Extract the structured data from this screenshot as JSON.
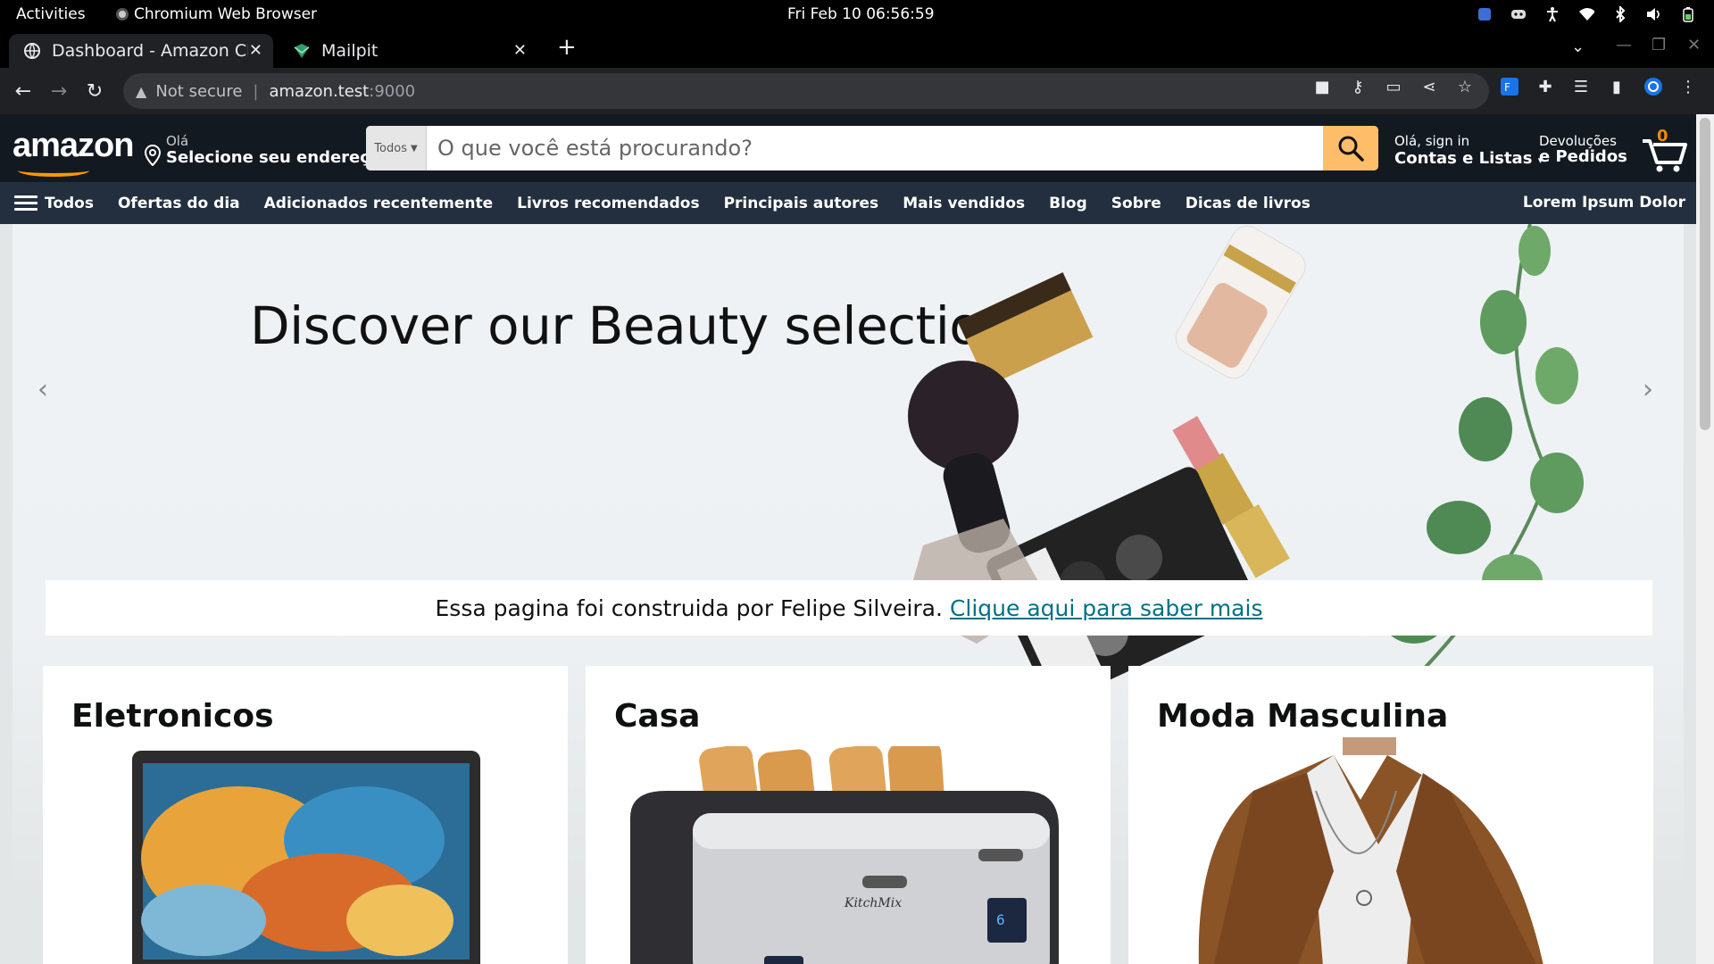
{
  "system_bar": {
    "activities": "Activities",
    "app_name": "Chromium Web Browser",
    "clock": "Fri Feb 10  06:56:59"
  },
  "browser": {
    "tabs": [
      {
        "label": "Dashboard - Amazon Clo",
        "active": true
      },
      {
        "label": "Mailpit",
        "active": false
      }
    ],
    "omnibox": {
      "security": "Not secure",
      "host": "amazon.test",
      "port": ":9000"
    }
  },
  "header": {
    "logo": "amazon",
    "address_line1": "Olá",
    "address_line2": "Selecione seu endereço",
    "search_category": "Todos",
    "search_placeholder": "O que você está procurando?",
    "account_line1": "Olá, sign in",
    "account_line2": "Contas e Listas",
    "orders_line1": "Devoluções",
    "orders_line2": "e Pedidos",
    "cart_count": "0"
  },
  "nav": {
    "all_label": "Todos",
    "items": [
      "Ofertas do dia",
      "Adicionados recentemente",
      "Livros recomendados",
      "Principais autores",
      "Mais vendidos",
      "Blog",
      "Sobre",
      "Dicas de livros"
    ],
    "right_label": "Lorem Ipsum Dolor"
  },
  "hero": {
    "title": "Discover our Beauty selection"
  },
  "notice": {
    "text": "Essa pagina foi construida por Felipe Silveira.",
    "link": "Clique aqui para saber mais"
  },
  "cards": [
    {
      "title": "Eletronicos"
    },
    {
      "title": "Casa"
    },
    {
      "title": "Moda Masculina"
    }
  ],
  "colors": {
    "amazon_dark": "#131921",
    "amazon_nav": "#232f3e",
    "search_button": "#febd69",
    "link": "#007185",
    "cart_count": "#f08804"
  }
}
